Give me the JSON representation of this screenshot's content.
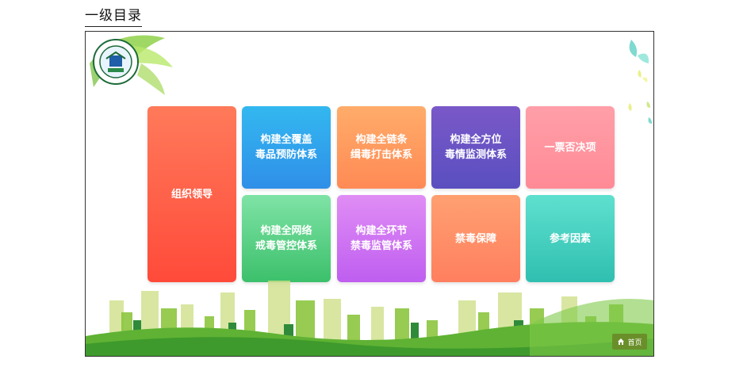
{
  "page": {
    "heading": "一级目录"
  },
  "tiles": [
    {
      "line1": "组织领导",
      "line2": "",
      "color_top": "#ff7a5a",
      "color_bottom": "#ff4a3a"
    },
    {
      "line1": "构建全覆盖",
      "line2": "毒品预防体系",
      "color_top": "#33b8f0",
      "color_bottom": "#2f8fe8"
    },
    {
      "line1": "构建全链条",
      "line2": "缉毒打击体系",
      "color_top": "#ffac6a",
      "color_bottom": "#ff8a55"
    },
    {
      "line1": "构建全方位",
      "line2": "毒情监测体系",
      "color_top": "#7a58c8",
      "color_bottom": "#5a4fc0"
    },
    {
      "line1": "一票否决项",
      "line2": "",
      "color_top": "#ff9fa8",
      "color_bottom": "#ff8a96"
    },
    {
      "line1": "构建全网络",
      "line2": "戒毒管控体系",
      "color_top": "#7fe3a6",
      "color_bottom": "#3cc06b"
    },
    {
      "line1": "构建全环节",
      "line2": "禁毒监管体系",
      "color_top": "#e08df5",
      "color_bottom": "#bf5ef0"
    },
    {
      "line1": "禁毒保障",
      "line2": "",
      "color_top": "#ffa071",
      "color_bottom": "#ff7f5f"
    },
    {
      "line1": "参考因素",
      "line2": "",
      "color_top": "#5fe0cf",
      "color_bottom": "#2fbfb0"
    }
  ],
  "home": {
    "label": "首页",
    "icon": "home-icon"
  }
}
